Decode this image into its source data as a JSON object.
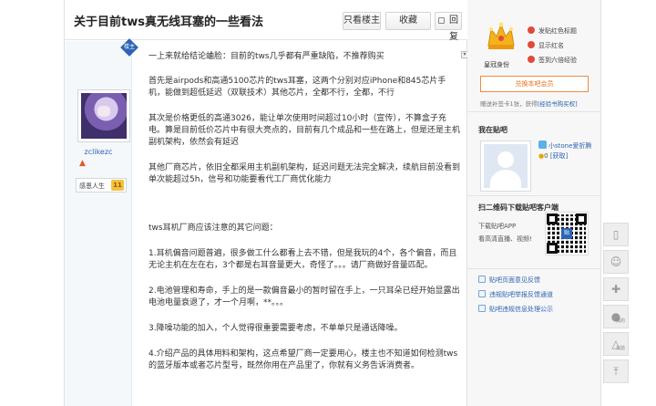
{
  "thread": {
    "title": "关于目前tws真无线耳塞的一些看法",
    "only_op_label": "只看楼主",
    "favorite_label": "收藏",
    "reply_label": "回复"
  },
  "author": {
    "op_badge": "楼主",
    "username": "zclikezc",
    "level_name": "感恩人生",
    "level_num": "11"
  },
  "post": {
    "paragraphs": [
      "一上来就给结论蛐脸：目前的tws几乎都有严重缺陷，不推荐购买",
      "首先是airpods和高通5100芯片的tws耳塞，这两个分别对应iPhone和845芯片手机，能做到超低延迟（双联技术）其他芯片，全都不行，全都，不行",
      "其次是价格更低的高通3026，能让单次使用时间超过10小时（宣传），不算盒子充电。算是目前低价芯片中有很大亮点的，目前有几个成品和一些在路上，但是还是主机副机架构，依然会有延迟",
      "其他厂商芯片，依旧全都采用主机副机架构，延迟问题无法完全解决，续航目前没看到单次能超过5h，信号和功能要看代工厂商优化能力",
      "tws耳机厂商应该注意的其它问题：",
      "1.耳机偏音问题普遍，很多做工什么都看上去不错，但是我玩的4个，各个偏音，而且无论主机在左在右，3个都是右耳音量更大，奇怪了。。。请厂商做好音量匹配。",
      "2.电池管理和寿命，手上的是一款偏音最小的暂时留在手上，一只耳朵已经开始显露出电池电量衰退了，才一个月啊，**。。。",
      "3.降噪功能的加入，个人觉得很重要需要考虑，不单单只是通话降噪。",
      "4.介绍产品的具体用料和架构，这点希望厂商一定要用心，楼主也不知道如何检测tws的蓝牙版本或者芯片型号，既然你用在产品里了，你就有义务告诉消费者。"
    ]
  },
  "sidebar": {
    "identity_label": "皇冠身份",
    "perks": [
      "发贴红色标题",
      "显示红名",
      "签到六倍经验"
    ],
    "vip_button": "兑换本吧会员",
    "buqian_text": "赠送补签卡1张，获得",
    "buqian_link": "[经验书购买权]",
    "my_bar_title": "我在贴吧",
    "my_name": "小stone爱折腾",
    "my_coins": "0",
    "my_coins_link": "[获取]",
    "app_title": "扫二维码下载贴吧客户端",
    "app_line1": "下载贴吧APP",
    "app_line2": "看高清直播、视频!",
    "qr_center": "贴",
    "links": [
      "贴吧页面意见反馈",
      "违规贴吧举报反馈通道",
      "贴吧违规信息处理公示"
    ]
  },
  "floatbar": {
    "buttons": [
      "app-download",
      "emoji",
      "plus",
      "profile",
      "lab",
      "back-to-top"
    ],
    "profile_sub": "我的",
    "lab_sub": "实验"
  },
  "colors": {
    "link": "#2d64b3",
    "accent_orange": "#e8731b",
    "crown_gold": "#f5b21c"
  }
}
